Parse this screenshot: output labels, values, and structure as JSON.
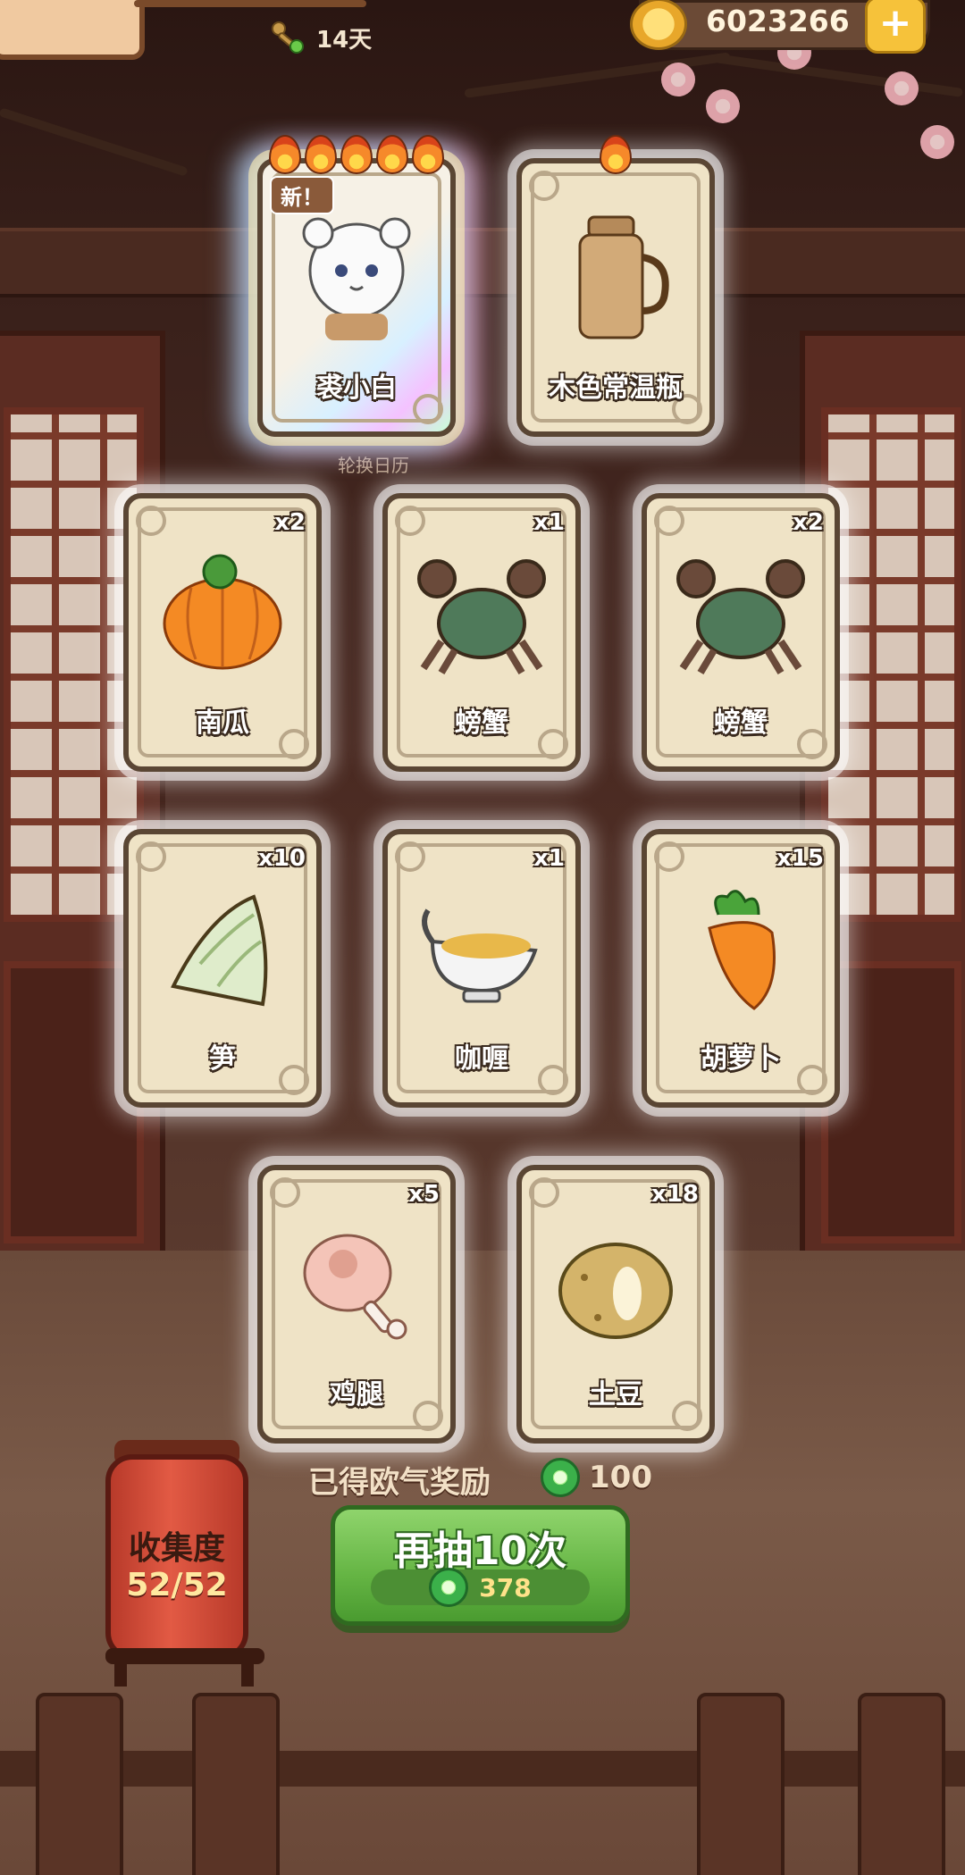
{
  "header": {
    "days": "14天",
    "coins": "6023266",
    "plus_symbol": "+"
  },
  "background": {
    "calendar_hint": "轮换日历"
  },
  "cards": [
    {
      "name": "裘小白",
      "count": "",
      "flames": 5,
      "badge": "新！",
      "rainbow": true,
      "icon": "white-cat-character"
    },
    {
      "name": "木色常温瓶",
      "count": "",
      "flames": 1,
      "badge": "",
      "rainbow": false,
      "icon": "wooden-thermos"
    },
    {
      "name": "南瓜",
      "count": "x2",
      "flames": 0,
      "badge": "",
      "rainbow": false,
      "icon": "pumpkin"
    },
    {
      "name": "螃蟹",
      "count": "x1",
      "flames": 0,
      "badge": "",
      "rainbow": false,
      "icon": "crab"
    },
    {
      "name": "螃蟹",
      "count": "x2",
      "flames": 0,
      "badge": "",
      "rainbow": false,
      "icon": "crab"
    },
    {
      "name": "笋",
      "count": "x10",
      "flames": 0,
      "badge": "",
      "rainbow": false,
      "icon": "bamboo-shoot"
    },
    {
      "name": "咖喱",
      "count": "x1",
      "flames": 0,
      "badge": "",
      "rainbow": false,
      "icon": "curry-gravy-boat"
    },
    {
      "name": "胡萝卜",
      "count": "x15",
      "flames": 0,
      "badge": "",
      "rainbow": false,
      "icon": "carrot"
    },
    {
      "name": "鸡腿",
      "count": "x5",
      "flames": 0,
      "badge": "",
      "rainbow": false,
      "icon": "chicken-leg"
    },
    {
      "name": "土豆",
      "count": "x18",
      "flames": 0,
      "badge": "",
      "rainbow": false,
      "icon": "potato"
    }
  ],
  "reward": {
    "label": "已得欧气奖励",
    "amount": "100"
  },
  "draw_button": {
    "label": "再抽10次",
    "cost": "378"
  },
  "collection": {
    "title": "收集度",
    "value": "52/52"
  },
  "colors": {
    "button_green": "#64b443",
    "card_bg": "#efe3c6",
    "lantern_red": "#e25a44",
    "jade": "#3bb04a"
  }
}
